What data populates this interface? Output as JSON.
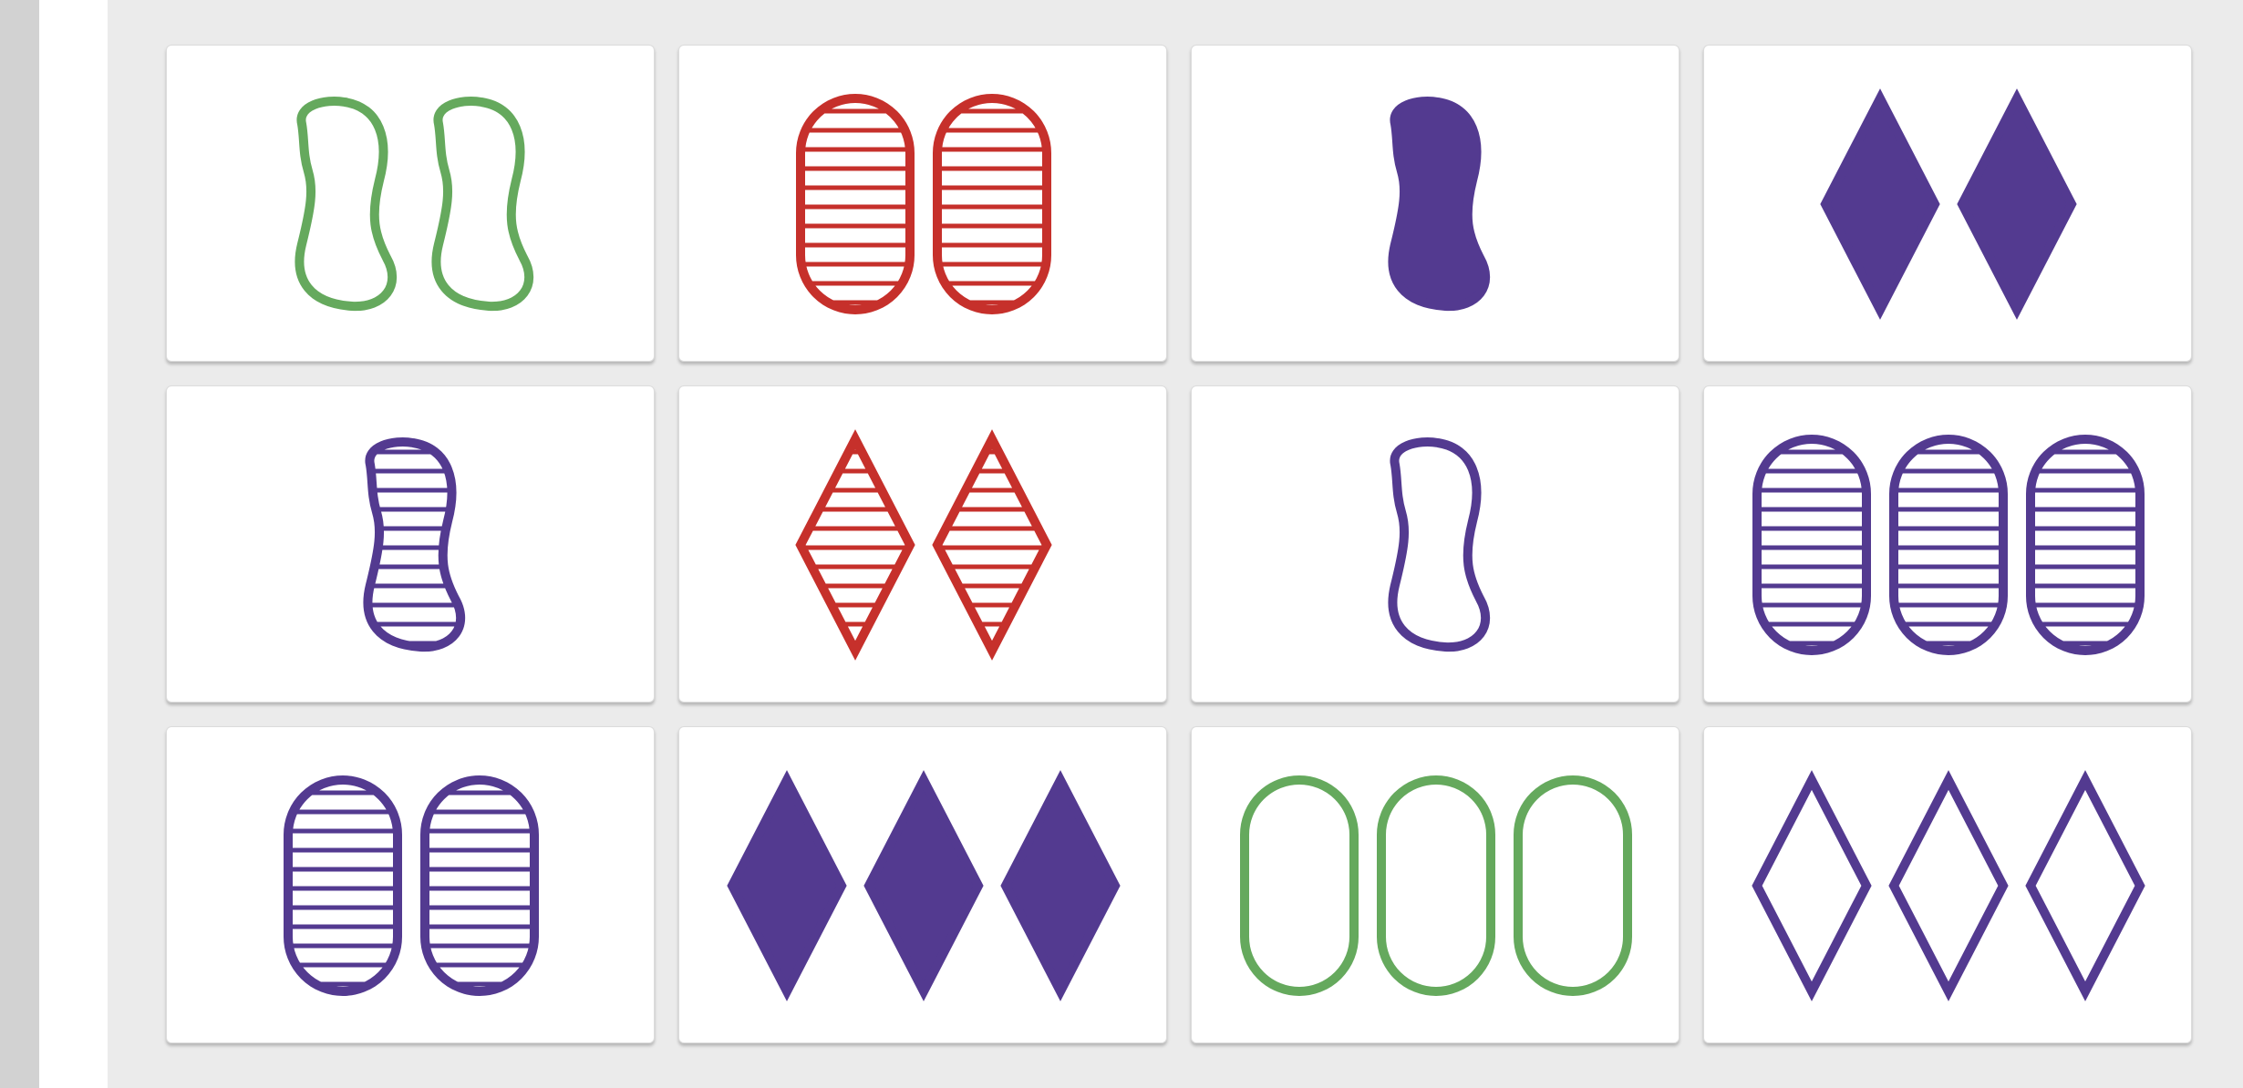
{
  "colors": {
    "red": "#c6302b",
    "green": "#65a95d",
    "purple": "#533a90",
    "background": "#ebebeb",
    "card": "#ffffff",
    "rail": "#d2d2d2"
  },
  "board": {
    "cards": [
      {
        "count": 2,
        "shape": "squiggle",
        "color": "green",
        "shading": "open"
      },
      {
        "count": 2,
        "shape": "oval",
        "color": "red",
        "shading": "striped"
      },
      {
        "count": 1,
        "shape": "squiggle",
        "color": "purple",
        "shading": "solid"
      },
      {
        "count": 2,
        "shape": "diamond",
        "color": "purple",
        "shading": "solid"
      },
      {
        "count": 1,
        "shape": "squiggle",
        "color": "purple",
        "shading": "striped"
      },
      {
        "count": 2,
        "shape": "diamond",
        "color": "red",
        "shading": "striped"
      },
      {
        "count": 1,
        "shape": "squiggle",
        "color": "purple",
        "shading": "open"
      },
      {
        "count": 3,
        "shape": "oval",
        "color": "purple",
        "shading": "striped"
      },
      {
        "count": 2,
        "shape": "oval",
        "color": "purple",
        "shading": "striped"
      },
      {
        "count": 3,
        "shape": "diamond",
        "color": "purple",
        "shading": "solid"
      },
      {
        "count": 3,
        "shape": "oval",
        "color": "green",
        "shading": "open"
      },
      {
        "count": 3,
        "shape": "diamond",
        "color": "purple",
        "shading": "open"
      }
    ]
  }
}
